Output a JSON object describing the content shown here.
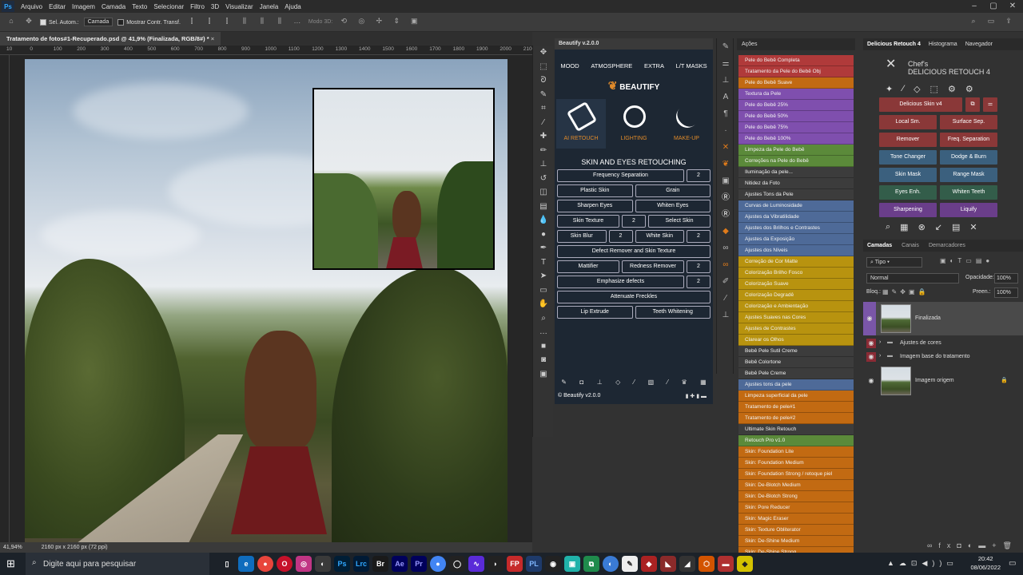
{
  "menu": [
    "Arquivo",
    "Editar",
    "Imagem",
    "Camada",
    "Texto",
    "Selecionar",
    "Filtro",
    "3D",
    "Visualizar",
    "Janela",
    "Ajuda"
  ],
  "options": {
    "auto_select_label": "Sel. Autom.:",
    "auto_select_value": "Camada",
    "show_transform_label": "Mostrar Contr. Transf.",
    "mode3d_label": "Modo 3D:"
  },
  "document": {
    "tab_title": "Tratamento de fotos#1-Recuperado.psd @ 41,9% (Finalizada, RGB/8#) *",
    "ruler_ticks": [
      "10",
      "0",
      "100",
      "200",
      "300",
      "400",
      "500",
      "600",
      "700",
      "800",
      "900",
      "1000",
      "1100",
      "1200",
      "1300",
      "1400",
      "1500",
      "1600",
      "1700",
      "1800",
      "1900",
      "2000",
      "2100"
    ],
    "zoom": "41,94%",
    "dimensions": "2160 px x 2160 px (72 ppi)"
  },
  "beautify": {
    "header": "Beautify v.2.0.0",
    "tabs": [
      "MOOD",
      "ATMOSPHERE",
      "EXTRA",
      "L/T MASKS"
    ],
    "logo_text": "BEAUTIFY",
    "modes": [
      {
        "label": "AI RETOUCH",
        "icon": "brush-icon"
      },
      {
        "label": "LIGHTING",
        "icon": "mirror-icon"
      },
      {
        "label": "MAKE-UP",
        "icon": "makeup-brush-icon"
      }
    ],
    "section_title": "SKIN AND EYES RETOUCHING",
    "buttons": {
      "freq_sep": "Frequency Separation",
      "freq_num": "2",
      "plastic": "Plastic Skin",
      "grain": "Grain",
      "sharpen_eyes": "Sharpen Eyes",
      "whiten_eyes": "Whiten Eyes",
      "skin_texture": "Skin Texture",
      "skin_texture_num": "2",
      "select_skin": "Select Skin",
      "skin_blur": "Skin Blur",
      "skin_blur_num": "2",
      "white_skin": "White Skin",
      "white_skin_num": "2",
      "defect": "Defect Remover and Skin Texture",
      "mattifier": "Mattifier",
      "redness": "Redness Remover",
      "redness_num": "2",
      "emphasize": "Emphasize defects",
      "emphasize_num": "2",
      "freckles": "Attenuate Freckles",
      "lip": "Lip Extrude",
      "teeth": "Teeth Whitening"
    },
    "footer": "© Beautify v2.0.0"
  },
  "actions": {
    "header": "Ações",
    "items": [
      {
        "label": "Pele do Bebê Completa",
        "color": "#b03a3a"
      },
      {
        "label": "Tratamento da Pele do Bebê Obj",
        "color": "#b03a3a"
      },
      {
        "label": "Pele do Bebê Suave",
        "color": "#c26a12"
      },
      {
        "label": "Textura da Pele",
        "color": "#7f4fae"
      },
      {
        "label": "Pele do Bebê 25%",
        "color": "#7f4fae"
      },
      {
        "label": "Pele do Bebê 50%",
        "color": "#7f4fae"
      },
      {
        "label": "Pele do Bebê 75%",
        "color": "#7f4fae"
      },
      {
        "label": "Pele do Bebê 100%",
        "color": "#7f4fae"
      },
      {
        "label": "Limpeza da Pele do Bebê",
        "color": "#5b8a3a"
      },
      {
        "label": "Correções na Pele do Bebê",
        "color": "#5b8a3a"
      },
      {
        "label": "Iluminação da pele...",
        "color": "#3c3c3c"
      },
      {
        "label": "Nitidez da Foto",
        "color": "#3c3c3c"
      },
      {
        "label": "Ajustes Tons da Pele",
        "color": "#3c3c3c"
      },
      {
        "label": "Curvas de Luminosidade",
        "color": "#4e6a98"
      },
      {
        "label": "Ajustes da Vibratilidade",
        "color": "#4e6a98"
      },
      {
        "label": "Ajustes dos Brilhos e Contrastes",
        "color": "#4e6a98"
      },
      {
        "label": "Ajustes da Exposição",
        "color": "#4e6a98"
      },
      {
        "label": "Ajustes dos Níveis",
        "color": "#4e6a98"
      },
      {
        "label": "Correção de Cor Matte",
        "color": "#b8930f"
      },
      {
        "label": "Colorização Brilho Fosco",
        "color": "#b8930f"
      },
      {
        "label": "Colorização Suave",
        "color": "#b8930f"
      },
      {
        "label": "Colorização Degradê",
        "color": "#b8930f"
      },
      {
        "label": "Colorização e Ambientação",
        "color": "#b8930f"
      },
      {
        "label": "Ajustes Suaves nas Cores",
        "color": "#b8930f"
      },
      {
        "label": "Ajustes de Contrastes",
        "color": "#b8930f"
      },
      {
        "label": "Clarear os Olhos",
        "color": "#b8930f"
      },
      {
        "label": "Bebê Pele Sutil Creme",
        "color": "#3c3c3c"
      },
      {
        "label": "Bebê Colortone",
        "color": "#3c3c3c"
      },
      {
        "label": "Bebê Pele Creme",
        "color": "#3c3c3c"
      },
      {
        "label": "Ajustes tons da pele",
        "color": "#4e6a98"
      },
      {
        "label": "Limpeza superficial da pele",
        "color": "#c26a12"
      },
      {
        "label": "Tratamento de pele#1",
        "color": "#c26a12"
      },
      {
        "label": "Tratamento de pele#2",
        "color": "#c26a12"
      },
      {
        "label": "Ultimate Skin Retouch",
        "color": "#3c3c3c"
      },
      {
        "label": "Retouch Pro v1.0",
        "color": "#5b8a3a"
      },
      {
        "label": "Skin: Foundation Lite",
        "color": "#c26a12"
      },
      {
        "label": "Skin: Foundation Medium",
        "color": "#c26a12"
      },
      {
        "label": "Skin: Foundation Strong / retoque piel",
        "color": "#c26a12"
      },
      {
        "label": "Skin: De-Blotch Medium",
        "color": "#c26a12"
      },
      {
        "label": "Skin: De-Blotch Strong",
        "color": "#c26a12"
      },
      {
        "label": "Skin: Pore Reducer",
        "color": "#c26a12"
      },
      {
        "label": "Skin: Magic Eraser",
        "color": "#c26a12"
      },
      {
        "label": "Skin: Texture Obliterator",
        "color": "#c26a12"
      },
      {
        "label": "Skin: De-Shine Medium",
        "color": "#c26a12"
      },
      {
        "label": "Skin: De-Shine Strong",
        "color": "#c26a12"
      }
    ]
  },
  "delicious": {
    "tabs": [
      "Delicious Retouch 4",
      "Histograma",
      "Navegador"
    ],
    "brand_line1": "Chef's",
    "brand_line2": "DELICIOUS RETOUCH 4",
    "delicious_skin": "Delicious Skin v4",
    "local_sm": "Local Sm.",
    "surface_sep": "Surface Sep.",
    "remover": "Remover",
    "freq_sep": "Freq. Separation",
    "tone_changer": "Tone Changer",
    "dodge_burn": "Dodge & Burn",
    "skin_mask": "Skin Mask",
    "range_mask": "Range Mask",
    "eyes_enh": "Eyes Enh.",
    "whiten_teeth": "Whiten Teeth",
    "sharpening": "Sharpening",
    "liquify": "Liquify"
  },
  "layers": {
    "tabs": [
      "Camadas",
      "Canais",
      "Demarcadores"
    ],
    "kind_label": "Tipo",
    "blend_mode": "Normal",
    "opacity_label": "Opacidade:",
    "opacity_value": "100%",
    "lock_label": "Bloq.:",
    "fill_label": "Preen.:",
    "fill_value": "100%",
    "items": [
      {
        "name": "Finalizada"
      },
      {
        "name": "Ajustes de cores"
      },
      {
        "name": "Imagem base do tratamento"
      },
      {
        "name": "Imagem origem"
      }
    ]
  },
  "taskbar": {
    "search_placeholder": "Digite aqui para pesquisar",
    "time": "20:42",
    "date": "08/06/2022"
  }
}
